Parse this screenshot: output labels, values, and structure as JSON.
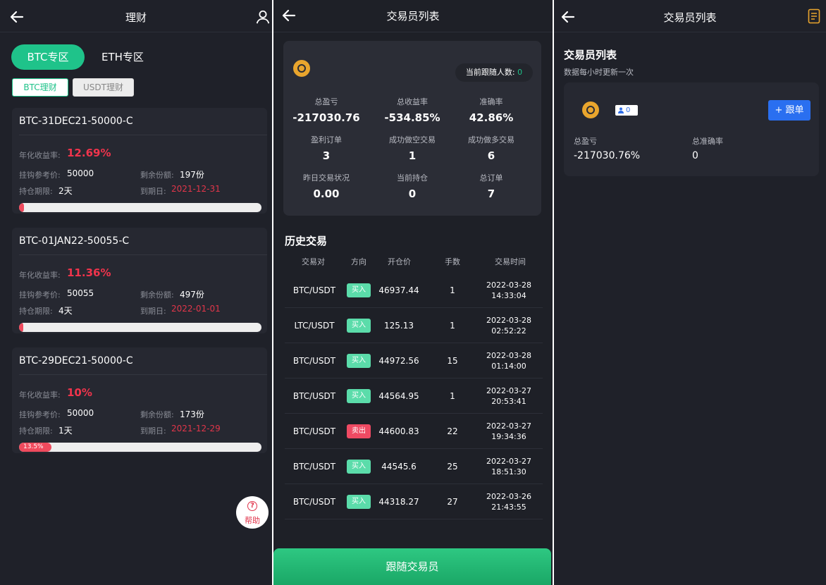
{
  "panel1": {
    "title": "理财",
    "tabs": [
      "BTC专区",
      "ETH专区"
    ],
    "subtabs": [
      "BTC理财",
      "USDT理财"
    ],
    "labels": {
      "annual_rate": "年化收益率:",
      "ref_price": "挂钩参考价:",
      "remaining": "剩余份额:",
      "period": "持仓期限:",
      "expiry": "到期日:"
    },
    "products": [
      {
        "name": "BTC-31DEC21-50000-C",
        "rate": "12.69%",
        "ref_price": "50000",
        "remaining": "197份",
        "period": "2天",
        "expiry": "2021-12-31",
        "progress_label": "",
        "progress": 0.02
      },
      {
        "name": "BTC-01JAN22-50055-C",
        "rate": "11.36%",
        "ref_price": "50055",
        "remaining": "497份",
        "period": "4天",
        "expiry": "2022-01-01",
        "progress_label": "",
        "progress": 0.01
      },
      {
        "name": "BTC-29DEC21-50000-C",
        "rate": "10%",
        "ref_price": "50000",
        "remaining": "173份",
        "period": "1天",
        "expiry": "2021-12-29",
        "progress_label": "13.5%",
        "progress": 0.135
      }
    ],
    "help_label": "帮助"
  },
  "panel2": {
    "title": "交易员列表",
    "followers_label": "当前跟随人数:",
    "followers_count": "0",
    "stats": [
      {
        "label": "总盈亏",
        "value": "-217030.76"
      },
      {
        "label": "总收益率",
        "value": "-534.85%"
      },
      {
        "label": "准确率",
        "value": "42.86%"
      },
      {
        "label": "盈利订单",
        "value": "3"
      },
      {
        "label": "成功做空交易",
        "value": "1"
      },
      {
        "label": "成功做多交易",
        "value": "6"
      },
      {
        "label": "昨日交易状况",
        "value": "0.00"
      },
      {
        "label": "当前持仓",
        "value": "0"
      },
      {
        "label": "总订单",
        "value": "7"
      }
    ],
    "history_title": "历史交易",
    "columns": [
      "交易对",
      "方向",
      "开仓价",
      "手数",
      "交易时间"
    ],
    "trades": [
      {
        "pair": "BTC/USDT",
        "dir": "买入",
        "side": "buy",
        "price": "46937.44",
        "qty": "1",
        "date": "2022-03-28",
        "time": "14:33:04"
      },
      {
        "pair": "LTC/USDT",
        "dir": "买入",
        "side": "buy",
        "price": "125.13",
        "qty": "1",
        "date": "2022-03-28",
        "time": "02:52:22"
      },
      {
        "pair": "BTC/USDT",
        "dir": "买入",
        "side": "buy",
        "price": "44972.56",
        "qty": "15",
        "date": "2022-03-28",
        "time": "01:14:00"
      },
      {
        "pair": "BTC/USDT",
        "dir": "买入",
        "side": "buy",
        "price": "44564.95",
        "qty": "1",
        "date": "2022-03-27",
        "time": "20:53:41"
      },
      {
        "pair": "BTC/USDT",
        "dir": "卖出",
        "side": "sell",
        "price": "44600.83",
        "qty": "22",
        "date": "2022-03-27",
        "time": "19:34:36"
      },
      {
        "pair": "BTC/USDT",
        "dir": "买入",
        "side": "buy",
        "price": "44545.6",
        "qty": "25",
        "date": "2022-03-27",
        "time": "18:51:30"
      },
      {
        "pair": "BTC/USDT",
        "dir": "买入",
        "side": "buy",
        "price": "44318.27",
        "qty": "27",
        "date": "2022-03-26",
        "time": "21:43:55"
      }
    ],
    "follow_button": "跟随交易员"
  },
  "panel3": {
    "title": "交易员列表",
    "heading": "交易员列表",
    "subheading": "数据每小时更新一次",
    "follower_count": "0",
    "follow_label": "+ 跟单",
    "pnl_label": "总盈亏",
    "pnl_value": "-217030.76%",
    "accuracy_label": "总准确率",
    "accuracy_value": "0"
  },
  "colors": {
    "background": "#1f2129",
    "card": "#262831",
    "accent_green": "#1fc38a",
    "accent_red": "#f0344c",
    "accent_blue": "#2a6ff0"
  },
  "icons": [
    "back-arrow-icon",
    "user-icon",
    "coin-icon",
    "question-icon",
    "document-icon",
    "person-icon"
  ]
}
